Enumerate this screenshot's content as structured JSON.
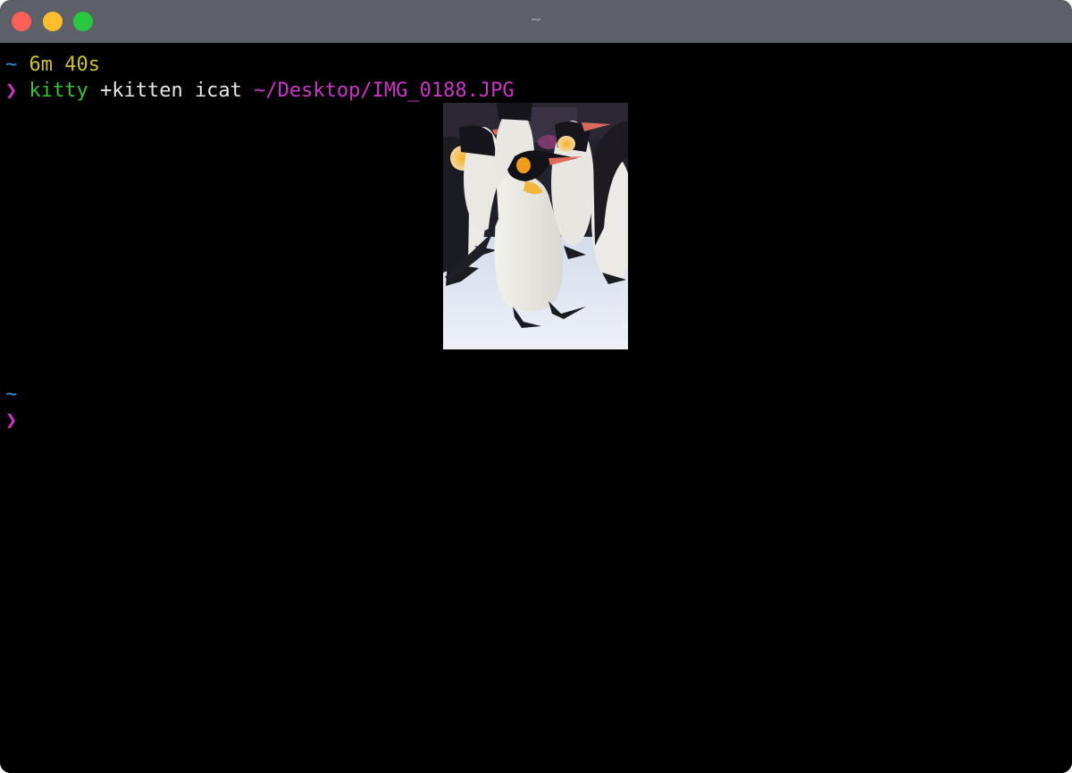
{
  "window": {
    "title": "~"
  },
  "terminal": {
    "line1": {
      "cwd": "~",
      "duration": "6m 40s"
    },
    "line2": {
      "prompt": "❯",
      "command": "kitty",
      "args": " +kitten icat ",
      "path": "~/Desktop/IMG_0188.JPG"
    },
    "line3": {
      "cwd": "~"
    },
    "line4": {
      "prompt": "❯"
    }
  },
  "image": {
    "subject": "penguins-photo"
  },
  "colors": {
    "background": "#000000",
    "titlebar": "#5d6066",
    "cwd": "#2a8cd6",
    "duration": "#c9c233",
    "prompt": "#cc33c7",
    "command": "#33c233",
    "path": "#cc33c7"
  }
}
